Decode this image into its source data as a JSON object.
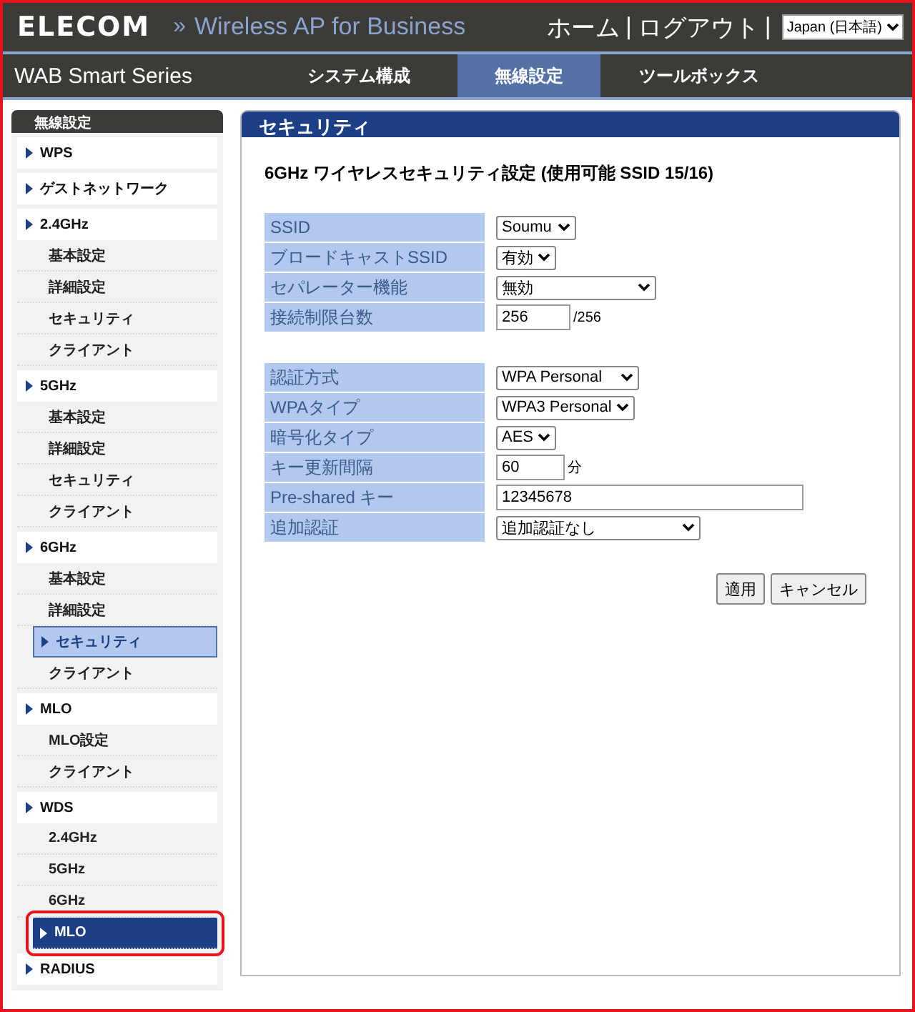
{
  "header": {
    "logo": "ELECOM",
    "separator": "»",
    "product": "Wireless AP for Business",
    "links": [
      "ホーム",
      "ログアウト"
    ],
    "dividers": [
      "|",
      "|"
    ],
    "language": "Japan (日本語)"
  },
  "nav": {
    "series": "WAB Smart Series",
    "tabs": [
      {
        "label": "システム構成",
        "selected": false
      },
      {
        "label": "無線設定",
        "selected": true
      },
      {
        "label": "ツールボックス",
        "selected": false
      }
    ]
  },
  "sidebar": {
    "title": "無線設定",
    "groups": [
      {
        "label": "WPS"
      },
      {
        "label": "ゲストネットワーク"
      },
      {
        "label": "2.4GHz",
        "children": [
          {
            "label": "基本設定",
            "selected": false,
            "focused": false
          },
          {
            "label": "詳細設定",
            "selected": false,
            "focused": false
          },
          {
            "label": "セキュリティ",
            "selected": false,
            "focused": false
          },
          {
            "label": "クライアント",
            "selected": false,
            "focused": false
          }
        ]
      },
      {
        "label": "5GHz",
        "children": [
          {
            "label": "基本設定",
            "selected": false,
            "focused": false
          },
          {
            "label": "詳細設定",
            "selected": false,
            "focused": false
          },
          {
            "label": "セキュリティ",
            "selected": false,
            "focused": false
          },
          {
            "label": "クライアント",
            "selected": false,
            "focused": false
          }
        ]
      },
      {
        "label": "6GHz",
        "children": [
          {
            "label": "基本設定",
            "selected": false,
            "focused": false
          },
          {
            "label": "詳細設定",
            "selected": false,
            "focused": false
          },
          {
            "label": "セキュリティ",
            "selected": true,
            "focused": false
          },
          {
            "label": "クライアント",
            "selected": false,
            "focused": false
          }
        ]
      },
      {
        "label": "MLO",
        "children": [
          {
            "label": "MLO設定",
            "selected": false,
            "focused": false
          },
          {
            "label": "クライアント",
            "selected": false,
            "focused": false
          }
        ]
      },
      {
        "label": "WDS",
        "children": [
          {
            "label": "2.4GHz",
            "selected": false,
            "focused": false
          },
          {
            "label": "5GHz",
            "selected": false,
            "focused": false
          },
          {
            "label": "6GHz",
            "selected": false,
            "focused": false
          },
          {
            "label": "MLO",
            "selected": false,
            "focused": true
          }
        ]
      },
      {
        "label": "RADIUS"
      }
    ]
  },
  "panel": {
    "title": "セキュリティ",
    "heading": "6GHz ワイヤレスセキュリティ設定 (使用可能 SSID 15/16)",
    "sections": [
      [
        {
          "label": "SSID",
          "kind": "select",
          "value": "Soumu"
        },
        {
          "label": "ブロードキャストSSID",
          "kind": "select",
          "value": "有効"
        },
        {
          "label": "セパレーター機能",
          "kind": "select",
          "value": "無効"
        },
        {
          "label": "接続制限台数",
          "kind": "text",
          "value": "256",
          "suffix": "/256"
        }
      ],
      [
        {
          "label": "認証方式",
          "kind": "select",
          "value": "WPA Personal"
        },
        {
          "label": "WPAタイプ",
          "kind": "select",
          "value": "WPA3 Personal"
        },
        {
          "label": "暗号化タイプ",
          "kind": "select",
          "value": "AES"
        },
        {
          "label": "キー更新間隔",
          "kind": "text",
          "value": "60",
          "suffix": "分"
        },
        {
          "label": "Pre-shared キー",
          "kind": "text",
          "value": "12345678"
        },
        {
          "label": "追加認証",
          "kind": "select",
          "value": "追加認証なし"
        }
      ]
    ],
    "buttons": [
      "適用",
      "キャンセル"
    ]
  }
}
